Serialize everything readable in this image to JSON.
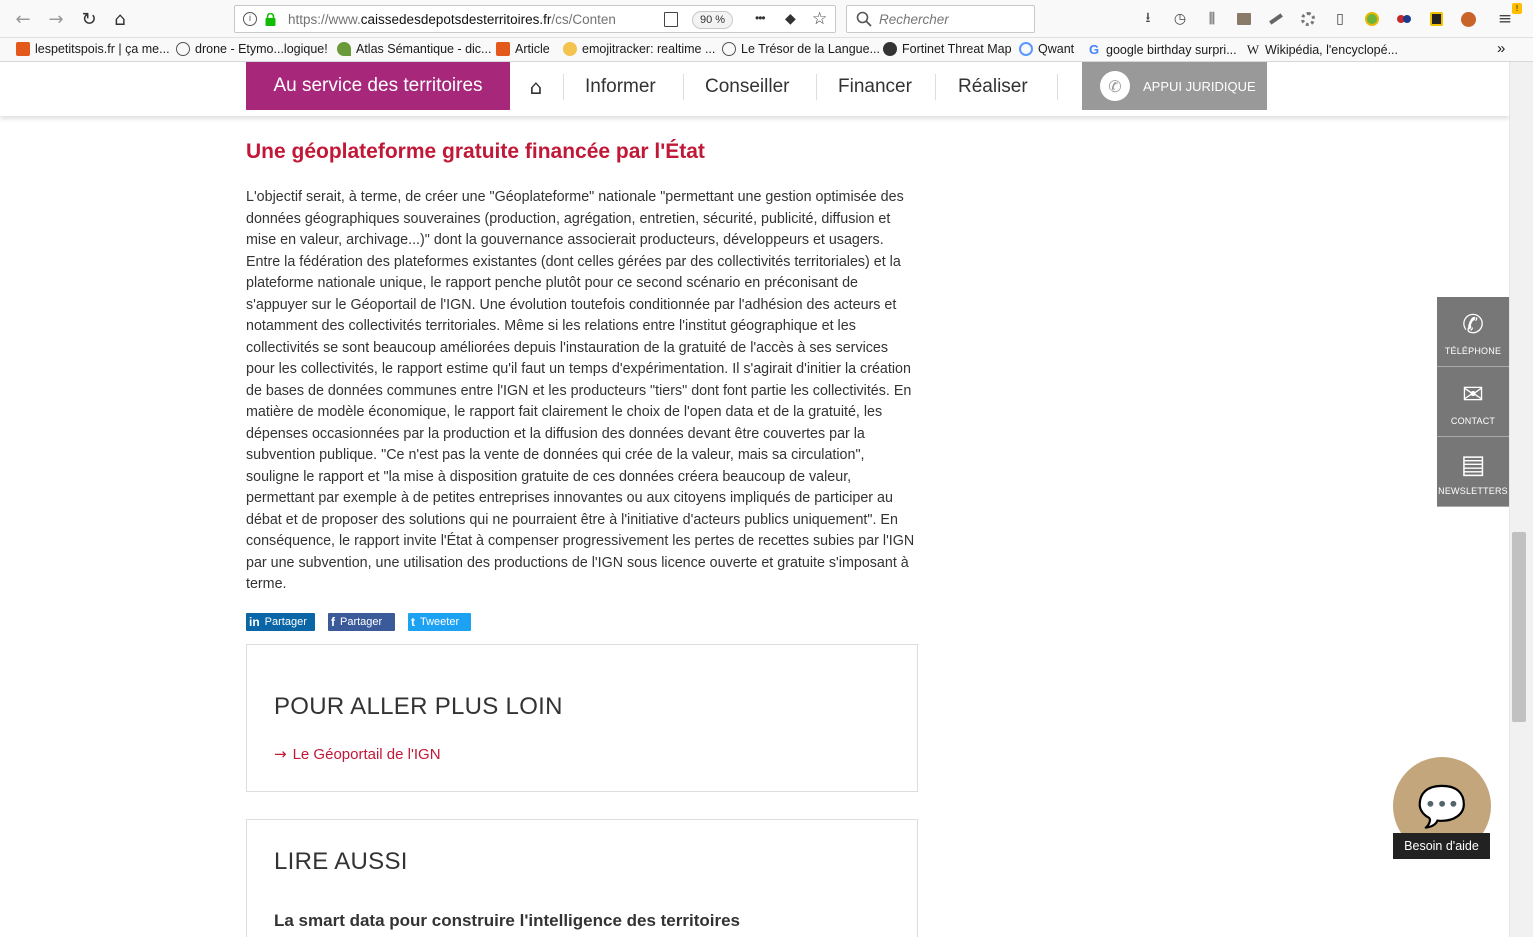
{
  "browser": {
    "url_prefix": "https://www.",
    "url_domain": "caissedesdepotsdesterritoires.fr",
    "url_path": "/cs/Conten",
    "zoom": "90 %",
    "search_placeholder": "Rechercher",
    "nav": {
      "back": "←",
      "forward": "→",
      "reload": "↻",
      "home": "⌂"
    },
    "icons": {
      "more": "•••",
      "pocket": "◆",
      "star": "☆",
      "download": "⭳",
      "history": "◷",
      "library": "⫼",
      "sidebar": "▯",
      "menu": "≡"
    }
  },
  "bookmarks": [
    {
      "label": "lespetitspois.fr | ça me...",
      "color": "#e2591b"
    },
    {
      "label": "drone - Etymo...logique!",
      "color": "#888888"
    },
    {
      "label": "Atlas Sémantique - dic...",
      "color": "#6a9a3a"
    },
    {
      "label": "Article",
      "color": "#e2591b"
    },
    {
      "label": "emojitracker: realtime ...",
      "color": "#f3c34e"
    },
    {
      "label": "Le Trésor de la Langue...",
      "color": "#888888"
    },
    {
      "label": "Fortinet Threat Map",
      "color": "#333333"
    },
    {
      "label": "Qwant",
      "color": "#5c97ff"
    },
    {
      "label": "google birthday surpri...",
      "color": "#4285f4"
    },
    {
      "label": "Wikipédia, l'encyclopé...",
      "color": "#333333"
    }
  ],
  "sitenav": {
    "brand": "Au service des territoires",
    "home_icon": "⌂",
    "items": [
      "Informer",
      "Conseiller",
      "Financer",
      "Réaliser"
    ],
    "appui_label": "APPUI JURIDIQUE",
    "phone_icon": "✆"
  },
  "article": {
    "heading": "Une géoplateforme gratuite financée par l'État",
    "body": "L'objectif serait, à terme, de créer une \"Géoplateforme\" nationale \"permettant une gestion optimisée des données géographiques souveraines (production, agrégation, entretien, sécurité, publicité, diffusion et mise en valeur, archivage...)\" dont la gouvernance associerait producteurs, développeurs et usagers. Entre la fédération des plateformes existantes (dont celles gérées par des collectivités territoriales) et la plateforme nationale unique, le rapport penche plutôt pour ce second scénario en préconisant de s'appuyer sur le Géoportail de l'IGN. Une évolution toutefois conditionnée par l'adhésion des acteurs et notamment des collectivités territoriales. Même si les relations entre l'institut géographique et les collectivités se sont beaucoup améliorées depuis l'instauration de la gratuité de l'accès à ses services pour les collectivités, le rapport estime qu'il faut un temps d'expérimentation. Il s'agirait d'initier la création de bases de données communes entre l'IGN et les producteurs \"tiers\" dont font partie les collectivités. En matière de modèle économique, le rapport fait clairement le choix de l'open data et de la gratuité, les dépenses occasionnées par la production et la diffusion des données devant être couvertes par la subvention publique. \"Ce n'est pas la vente de données qui crée de la valeur, mais sa circulation\", souligne le rapport et \"la mise à disposition gratuite de ces données créera beaucoup de valeur, permettant par exemple à de petites entreprises innovantes ou aux citoyens impliqués de participer au débat et de proposer des solutions qui ne pourraient être à l'initiative d'acteurs publics uniquement\". En conséquence, le rapport invite l'État à compenser progressivement les pertes de recettes subies par l'IGN par une subvention, une utilisation des productions de l'IGN sous licence ouverte et gratuite s'imposant à terme."
  },
  "share": [
    {
      "icon": "in",
      "label": "Partager",
      "color": "#0a66a6"
    },
    {
      "icon": "f",
      "label": "Partager",
      "color": "#3b5a9a"
    },
    {
      "icon": "t",
      "label": "Tweeter",
      "color": "#1da1f2"
    }
  ],
  "further": {
    "title": "POUR ALLER PLUS LOIN",
    "link_arrow": "→",
    "link": "Le Géoportail de l'IGN"
  },
  "read_also": {
    "title": "LIRE AUSSI",
    "item": "La smart data pour construire l'intelligence des territoires"
  },
  "side_tabs": [
    {
      "icon": "✆",
      "label": "TÉLÉPHONE"
    },
    {
      "icon": "✉",
      "label": "CONTACT"
    },
    {
      "icon": "▤",
      "label": "NEWSLETTERS"
    }
  ],
  "chat": {
    "icon": "💬",
    "label": "Besoin d'aide"
  },
  "colors": {
    "brand": "#a7277a",
    "accent_red": "#c21837",
    "chat": "#c4a67d"
  }
}
